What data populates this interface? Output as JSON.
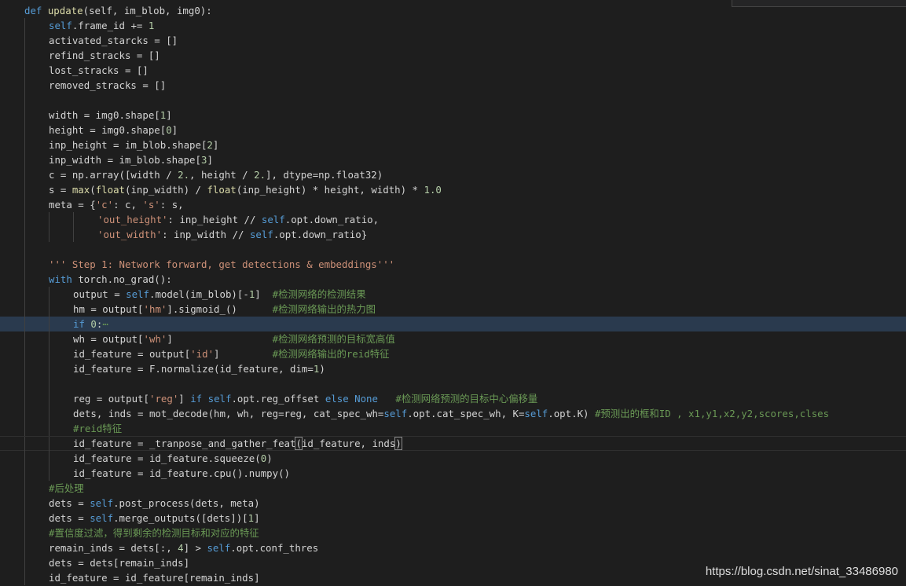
{
  "editor": {
    "current_line": 21,
    "lines": [
      {
        "indent": 0,
        "tokens": [
          [
            "kw",
            "def "
          ],
          [
            "fn",
            "update"
          ],
          [
            "",
            "(self, im_blob, img0):"
          ]
        ]
      },
      {
        "indent": 1,
        "tokens": [
          [
            "kw",
            "self"
          ],
          [
            "",
            ".frame_id += "
          ],
          [
            "nm",
            "1"
          ]
        ]
      },
      {
        "indent": 1,
        "tokens": [
          [
            "",
            "activated_starcks = []"
          ]
        ]
      },
      {
        "indent": 1,
        "tokens": [
          [
            "",
            "refind_stracks = []"
          ]
        ]
      },
      {
        "indent": 1,
        "tokens": [
          [
            "",
            "lost_stracks = []"
          ]
        ]
      },
      {
        "indent": 1,
        "tokens": [
          [
            "",
            "removed_stracks = []"
          ]
        ]
      },
      {
        "indent": 1,
        "guides": 1,
        "tokens": []
      },
      {
        "indent": 1,
        "tokens": [
          [
            "",
            "width = img0.shape["
          ],
          [
            "nm",
            "1"
          ],
          [
            "",
            "]"
          ]
        ]
      },
      {
        "indent": 1,
        "tokens": [
          [
            "",
            "height = img0.shape["
          ],
          [
            "nm",
            "0"
          ],
          [
            "",
            "]"
          ]
        ]
      },
      {
        "indent": 1,
        "tokens": [
          [
            "",
            "inp_height = im_blob.shape["
          ],
          [
            "nm",
            "2"
          ],
          [
            "",
            "]"
          ]
        ]
      },
      {
        "indent": 1,
        "tokens": [
          [
            "",
            "inp_width = im_blob.shape["
          ],
          [
            "nm",
            "3"
          ],
          [
            "",
            "]"
          ]
        ]
      },
      {
        "indent": 1,
        "tokens": [
          [
            "",
            "c = np.array([width / "
          ],
          [
            "nm",
            "2."
          ],
          [
            "",
            ", height / "
          ],
          [
            "nm",
            "2."
          ],
          [
            "",
            "], dtype=np.float32)"
          ]
        ]
      },
      {
        "indent": 1,
        "tokens": [
          [
            "",
            "s = "
          ],
          [
            "fn",
            "max"
          ],
          [
            "",
            "("
          ],
          [
            "fn",
            "float"
          ],
          [
            "",
            "(inp_width) / "
          ],
          [
            "fn",
            "float"
          ],
          [
            "",
            "(inp_height) * height, width) * "
          ],
          [
            "nm",
            "1.0"
          ]
        ]
      },
      {
        "indent": 1,
        "tokens": [
          [
            "",
            "meta = {"
          ],
          [
            "st",
            "'c'"
          ],
          [
            "",
            ": c, "
          ],
          [
            "st",
            "'s'"
          ],
          [
            "",
            ": s,"
          ]
        ]
      },
      {
        "indent": 1,
        "guides": 3,
        "extra_pad": "        ",
        "tokens": [
          [
            "st",
            "'out_height'"
          ],
          [
            "",
            ": inp_height // "
          ],
          [
            "kw",
            "self"
          ],
          [
            "",
            ".opt.down_ratio,"
          ]
        ]
      },
      {
        "indent": 1,
        "guides": 3,
        "extra_pad": "        ",
        "tokens": [
          [
            "st",
            "'out_width'"
          ],
          [
            "",
            ": inp_width // "
          ],
          [
            "kw",
            "self"
          ],
          [
            "",
            ".opt.down_ratio}"
          ]
        ]
      },
      {
        "indent": 1,
        "guides": 1,
        "tokens": []
      },
      {
        "indent": 1,
        "tokens": [
          [
            "st",
            "''' Step 1: Network forward, get detections & embeddings'''"
          ]
        ]
      },
      {
        "indent": 1,
        "tokens": [
          [
            "kw",
            "with "
          ],
          [
            "",
            "torch.no_grad():"
          ]
        ]
      },
      {
        "indent": 2,
        "tokens": [
          [
            "",
            "output = "
          ],
          [
            "kw",
            "self"
          ],
          [
            "",
            ".model(im_blob)[-"
          ],
          [
            "nm",
            "1"
          ],
          [
            "",
            "]  "
          ],
          [
            "cm",
            "#检测网络的检测结果"
          ]
        ]
      },
      {
        "indent": 2,
        "tokens": [
          [
            "",
            "hm = output["
          ],
          [
            "st",
            "'hm'"
          ],
          [
            "",
            "].sigmoid_()      "
          ],
          [
            "cm",
            "#检测网络输出的热力图"
          ]
        ]
      },
      {
        "indent": 2,
        "tokens": [
          [
            "kw",
            "if "
          ],
          [
            "nm",
            "0"
          ],
          [
            "",
            ":"
          ],
          [
            "cm",
            "⋯"
          ]
        ]
      },
      {
        "indent": 2,
        "tokens": [
          [
            "",
            "wh = output["
          ],
          [
            "st",
            "'wh'"
          ],
          [
            "",
            "]                 "
          ],
          [
            "cm",
            "#检测网络预测的目标宽高值"
          ]
        ]
      },
      {
        "indent": 2,
        "tokens": [
          [
            "",
            "id_feature = output["
          ],
          [
            "st",
            "'id'"
          ],
          [
            "",
            "]         "
          ],
          [
            "cm",
            "#检测网络输出的reid特征"
          ]
        ]
      },
      {
        "indent": 2,
        "tokens": [
          [
            "",
            "id_feature = F.normalize(id_feature, dim="
          ],
          [
            "nm",
            "1"
          ],
          [
            "",
            ")"
          ]
        ]
      },
      {
        "indent": 2,
        "guides": 2,
        "tokens": []
      },
      {
        "indent": 2,
        "tokens": [
          [
            "",
            "reg = output["
          ],
          [
            "st",
            "'reg'"
          ],
          [
            "",
            "] "
          ],
          [
            "kw",
            "if "
          ],
          [
            "kw",
            "self"
          ],
          [
            "",
            ".opt.reg_offset "
          ],
          [
            "kw",
            "else "
          ],
          [
            "kw",
            "None"
          ],
          [
            "",
            "   "
          ],
          [
            "cm",
            "#检测网络预测的目标中心偏移量"
          ]
        ]
      },
      {
        "indent": 2,
        "tokens": [
          [
            "",
            "dets, inds = mot_decode(hm, wh, reg=reg, cat_spec_wh="
          ],
          [
            "kw",
            "self"
          ],
          [
            "",
            ".opt.cat_spec_wh, K="
          ],
          [
            "kw",
            "self"
          ],
          [
            "",
            ".opt.K) "
          ],
          [
            "cm",
            "#预测出的框和ID , x1,y1,x2,y2,scores,clses"
          ]
        ]
      },
      {
        "indent": 2,
        "tokens": [
          [
            "cm",
            "#reid特征"
          ]
        ]
      },
      {
        "indent": 2,
        "tokens": [
          [
            "",
            "id_feature = _tranpose_and_gather_feat"
          ],
          [
            "bo",
            "("
          ],
          [
            "",
            "id_feature, inds"
          ],
          [
            "bo",
            ")"
          ]
        ]
      },
      {
        "indent": 2,
        "tokens": [
          [
            "",
            "id_feature = id_feature.squeeze("
          ],
          [
            "nm",
            "0"
          ],
          [
            "",
            ")"
          ]
        ]
      },
      {
        "indent": 2,
        "tokens": [
          [
            "",
            "id_feature = id_feature.cpu().numpy()"
          ]
        ]
      },
      {
        "indent": 1,
        "tokens": [
          [
            "cm",
            "#后处理"
          ]
        ]
      },
      {
        "indent": 1,
        "tokens": [
          [
            "",
            "dets = "
          ],
          [
            "kw",
            "self"
          ],
          [
            "",
            ".post_process(dets, meta)"
          ]
        ]
      },
      {
        "indent": 1,
        "tokens": [
          [
            "",
            "dets = "
          ],
          [
            "kw",
            "self"
          ],
          [
            "",
            ".merge_outputs([dets])["
          ],
          [
            "nm",
            "1"
          ],
          [
            "",
            "]"
          ]
        ]
      },
      {
        "indent": 1,
        "tokens": [
          [
            "cm",
            "#置信度过滤，得到剩余的检测目标和对应的特征"
          ]
        ]
      },
      {
        "indent": 1,
        "tokens": [
          [
            "",
            "remain_inds = dets[:, "
          ],
          [
            "nm",
            "4"
          ],
          [
            "",
            "] > "
          ],
          [
            "kw",
            "self"
          ],
          [
            "",
            ".opt.conf_thres"
          ]
        ]
      },
      {
        "indent": 1,
        "tokens": [
          [
            "",
            "dets = dets[remain_inds]"
          ]
        ]
      },
      {
        "indent": 1,
        "tokens": [
          [
            "",
            "id_feature = id_feature[remain_inds]"
          ]
        ]
      }
    ]
  },
  "colors": {
    "background": "#1e1e1e",
    "keyword": "#569cd6",
    "function": "#dcdcaa",
    "string": "#ce9178",
    "number": "#b5cea8",
    "comment": "#6a9955",
    "text": "#d4d4d4"
  },
  "watermark": "https://blog.csdn.net/sinat_33486980"
}
